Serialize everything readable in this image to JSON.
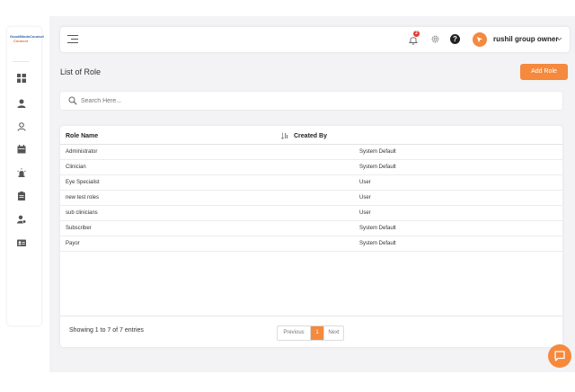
{
  "app": {
    "logo_line1": "GoodMindsCounsel",
    "logo_line2": "Connect"
  },
  "sidebar": {
    "items": [
      {
        "name": "dashboard",
        "icon": "grid-icon"
      },
      {
        "name": "users",
        "icon": "user-icon"
      },
      {
        "name": "profile",
        "icon": "user-outline-icon"
      },
      {
        "name": "calendar",
        "icon": "calendar-icon"
      },
      {
        "name": "alerts",
        "icon": "siren-icon"
      },
      {
        "name": "reports",
        "icon": "clipboard-icon"
      },
      {
        "name": "settings",
        "icon": "user-gear-icon"
      },
      {
        "name": "roles",
        "icon": "id-card-icon"
      }
    ]
  },
  "header": {
    "notification_count": "2",
    "help_glyph": "?",
    "user_name": "rushil group owner"
  },
  "page": {
    "title": "List of Role",
    "add_button": "Add Role"
  },
  "search": {
    "placeholder": "Search Here..."
  },
  "table": {
    "columns": [
      "Role Name",
      "Created By"
    ],
    "rows": [
      [
        "Administrator",
        "System Default"
      ],
      [
        "Clinician",
        "System Default"
      ],
      [
        "Eye Specialist",
        "User"
      ],
      [
        "new test roles",
        "User"
      ],
      [
        "sub clinicians",
        "User"
      ],
      [
        "Subscriber",
        "System Default"
      ],
      [
        "Payor",
        "System Default"
      ]
    ]
  },
  "pagination": {
    "summary": "Showing 1 to 7 of 7 entries",
    "previous": "Previous",
    "current": "1",
    "next": "Next"
  },
  "colors": {
    "accent": "#f5893d",
    "badge": "#e53935"
  }
}
